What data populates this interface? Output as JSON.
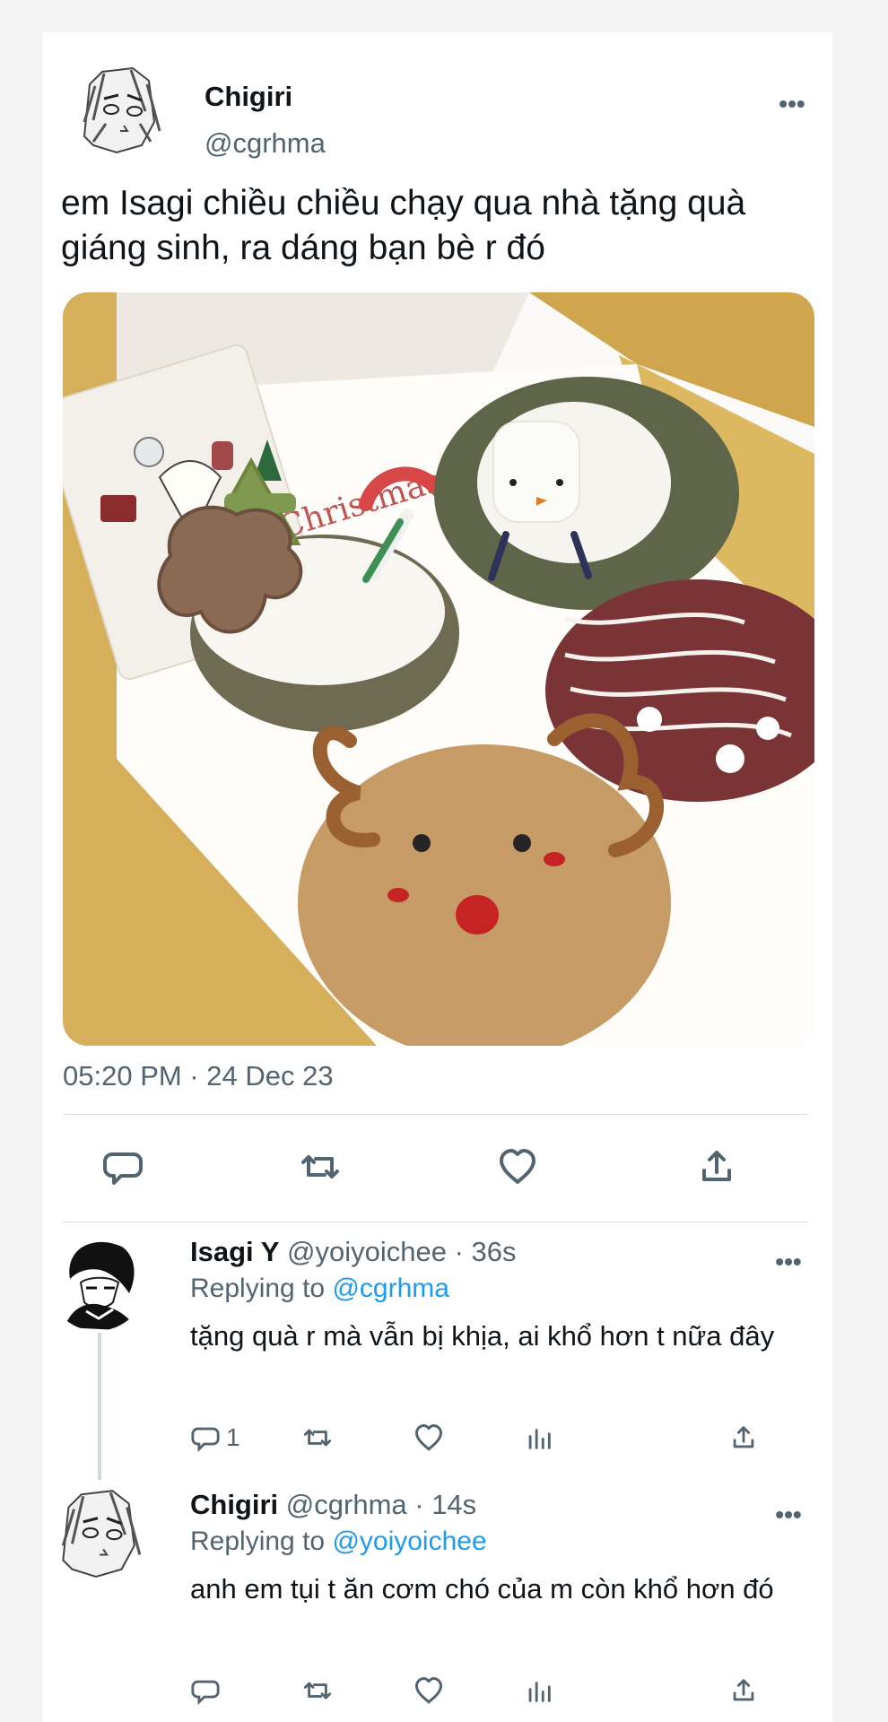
{
  "tweet": {
    "author_name": "Chigiri",
    "author_handle": "@cgrhma",
    "text": "em Isagi chiều chiều chạy qua nhà tặng quà giáng sinh, ra dáng bạn bè r đó",
    "timestamp": "05:20 PM · 24 Dec 23",
    "more_icon": "more-icon",
    "photo_card_text": "Merry Christmas",
    "actions": [
      {
        "name": "reply-icon"
      },
      {
        "name": "retweet-icon"
      },
      {
        "name": "like-icon"
      },
      {
        "name": "share-icon"
      }
    ]
  },
  "replies": [
    {
      "author_name": "Isagi Y",
      "author_handle": "@yoiyoichee",
      "time": " · 36s",
      "replying_prefix": "Replying to ",
      "replying_to": "@cgrhma",
      "text": "tặng quà r mà vẫn bị khịa, ai khổ hơn t nữa đây",
      "reply_count": "1"
    },
    {
      "author_name": "Chigiri",
      "author_handle": "@cgrhma",
      "time": " · 14s",
      "replying_prefix": "Replying to ",
      "replying_to": "@yoiyoichee",
      "text": "anh em tụi t ăn cơm chó của m còn khổ hơn đó",
      "reply_count": ""
    }
  ],
  "colors": {
    "link": "#1d9bf0",
    "muted": "#536471"
  }
}
